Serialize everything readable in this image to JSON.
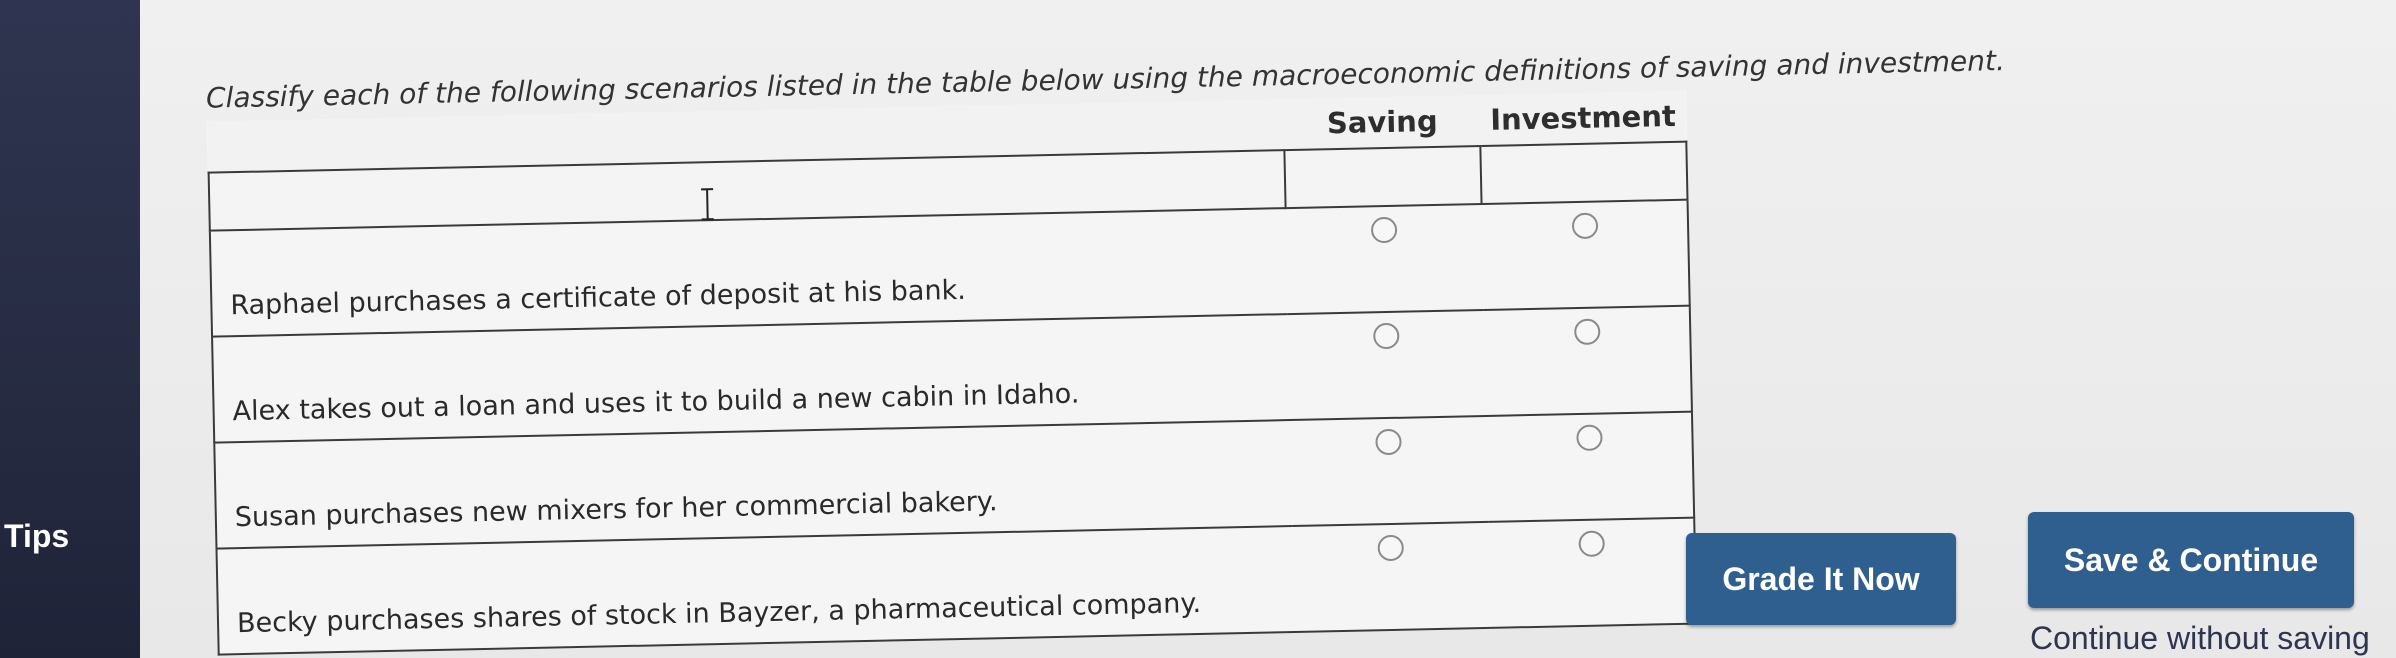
{
  "sidebar": {
    "items": [
      {
        "label": "Tips"
      }
    ],
    "bg_color": "#2f3550"
  },
  "question": {
    "instructions": "Classify each of the following scenarios listed in the table below using the macroeconomic definitions of saving and investment.",
    "columns": [
      "",
      "Saving",
      "Investment"
    ],
    "rows": [
      {
        "scenario": "Raphael purchases a certificate of deposit at his bank.",
        "saving_selected": false,
        "investment_selected": false
      },
      {
        "scenario": "Alex takes out a loan and uses it to build a new cabin in Idaho.",
        "saving_selected": false,
        "investment_selected": false
      },
      {
        "scenario": "Susan purchases new mixers for her commercial bakery.",
        "saving_selected": false,
        "investment_selected": false
      },
      {
        "scenario": "Becky purchases shares of stock in Bayzer, a pharmaceutical company.",
        "saving_selected": false,
        "investment_selected": false
      }
    ]
  },
  "actions": {
    "grade_label": "Grade It Now",
    "save_label": "Save & Continue",
    "continue_label": "Continue without saving",
    "button_color": "#2f5f8f"
  },
  "icons": {
    "cursor": "text-cursor-icon",
    "radio": "radio-button-icon"
  }
}
